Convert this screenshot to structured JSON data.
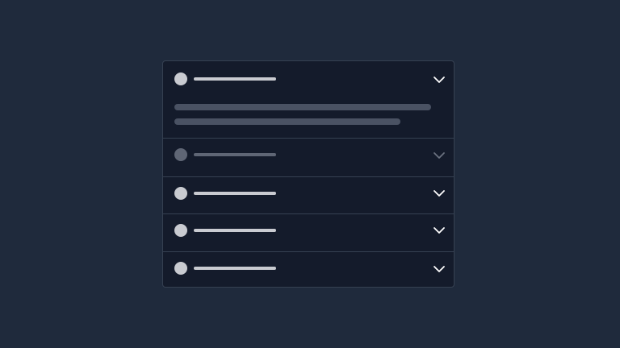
{
  "colors": {
    "page_background": "#1f2a3c",
    "card_background": "#141b2b",
    "border": "#364152",
    "active_placeholder": "#c9cbd1",
    "disabled_placeholder": "#5f6675",
    "panel_placeholder": "#4a5263",
    "chevron_active": "#ffffff",
    "chevron_disabled": "#6b7280"
  },
  "accordion": {
    "items": [
      {
        "state": "expanded",
        "icon": "chevron-down-icon"
      },
      {
        "state": "disabled",
        "icon": "chevron-down-icon"
      },
      {
        "state": "collapsed",
        "icon": "chevron-down-icon"
      },
      {
        "state": "collapsed",
        "icon": "chevron-down-icon"
      },
      {
        "state": "collapsed",
        "icon": "chevron-down-icon"
      }
    ]
  }
}
